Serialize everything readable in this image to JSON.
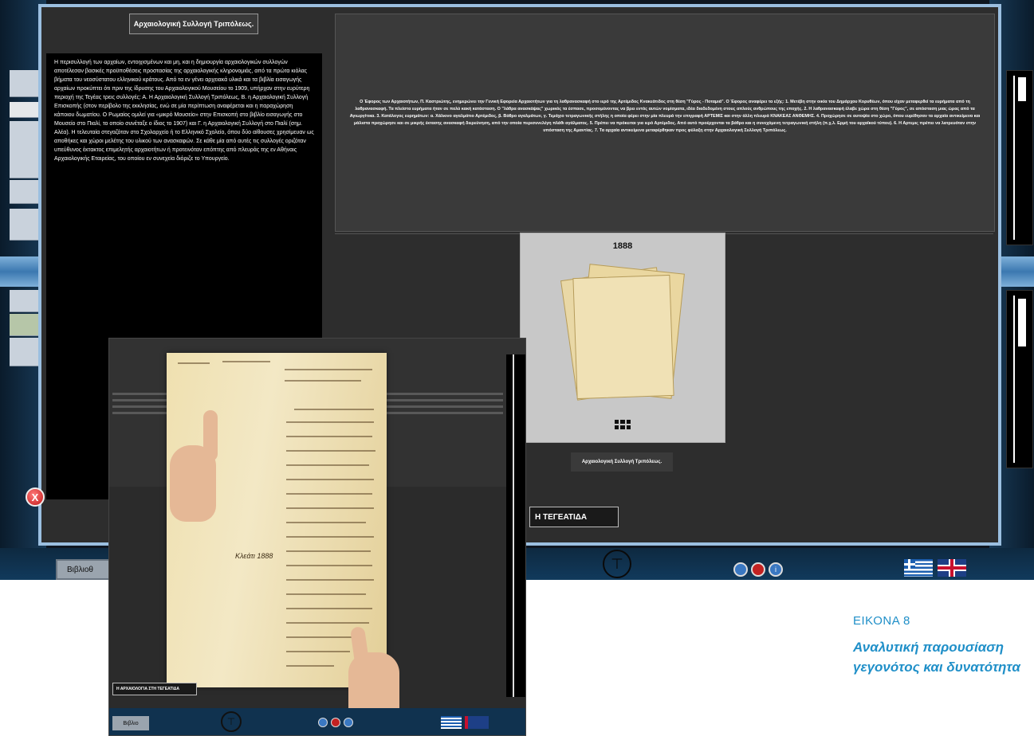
{
  "window": {
    "title": "Αρχαιολογική Συλλογή Τριπόλεως."
  },
  "left_panel": {
    "text": "Η περισυλλογή των αρχαίων, εντοιχισμένων και μη, και η δημιουργία αρχαιολογικών συλλογών αποτέλεσαν βασικές προϋποθέσεις προστασίας της αρχαιολογικής κληρονομιάς, από τα πρώτα κιόλας βήματα του νεοσύστατου ελληνικού κράτους. Από τα εν γένει αρχειακά υλικά και τα βιβλία εισαγωγής αρχαίων προκύπτει ότι πριν της ίδρυσης του Αρχαιολογικού Μουσείου το 1909, υπήρχαν στην ευρύτερη περιοχή της Τεγέας τρεις συλλογές: Α. Η Αρχαιολογική Συλλογή Τριπόλεως, Β. η Αρχαιολογική Συλλογή Επισκοπής (στον περίβολο της εκκλησίας, ενώ σε μία περίπτωση αναφέρεται και η παραχώρηση κάποιου δωματίου. Ο Ρωμαίος ομιλεί για «μικρό Μουσείο» στην Επισκοπή στο βιβλίο εισαγωγής στο Μουσείο στο Πιαλί, το οποίο συνέταξε ο ίδιος το 1907) και Γ. η Αρχαιολογική Συλλογή στο Πιαλί (σημ. Αλέα). Η τελευταία στεγαζόταν στο Σχολαρχείο ή το Ελληνικό Σχολείο, όπου δύο αίθουσες χρησίμευαν ως αποθήκες και χώροι μελέτης του υλικού των ανασκαφών. Σε κάθε μία από αυτές τις συλλογές οριζόταν υπεύθυνος έκτακτος επιμελητής αρχαιοτήτων ή προτεινόταν επόπτης από πλευράς της εν Αθήναις Αρχαιολογικής Εταιρείας, του οποίου εν συνεχεία διόριζε το Υπουργείο."
  },
  "right_panel": {
    "text": "Ο Έφορος των Αρχαιοτήτων, Π. Καστριώτης, ενημερώνει την Γενική Εφορεία Αρχαιοτήτων για τη λαθρανασκαφή στο ιερό της Αρτέμιδος Κνακεάτιδος στη θέση \"Γύρος - Ποταμιά\". Ο Έφορος αναφέρει τα εξής: 1. Μετέβη στην οικία του Δημάρχου Κορυθέων, όπου είχαν μεταφερθεί τα ευρήματα από τη λαθρανασκαφή. Τα πλείστα ευρήματα ήταν σε πολύ κακή κατάσταση. Ο \"λάθρα ανασκάψας\" χωρικός τα έσπασε, προσομένοντας να βρει εντός αυτών νομίσματα, ιδέα διαδεδομένη στους απλούς ανθρώπους της εποχής. 2. Η λαθρανασκαφή έλαβε χώρα στη θέση \"Γύρος\", σε απόσταση μιας ώρας από τα Αγιωργίτικα. 3. Κατάλογος ευρημάτων: α. Χάλκινο αγαλμάτιο Αρτέμιδος, β. Βάθρο αγαλμάτων, γ. Τεμάχιο τετραγωνικής στήλης η οποία φέρει στην μία πλευρά την επιγραφή ΑΡΤΕΜΙΣ και στην άλλη πλευρά ΚΝΑΚΕΑΣ ΑΝΘΕΜΗΣ. 4. Προχώρησε σε αυτοψία στο χώρο, όπου ευρέθησαν τα αρχαία αντικείμενα και μάλιστα προχώρησε και σε μικρής έκτασης ανασκαφή διερεύνηση, από την οποία περισυνελέγη πλάθι αγάλματος. 5. Πρέπει να πρόκειται για ιερό Αρτέμιδος. Από αυτό προέρχονται τα βάθρο και η συνεχόμενη τετραγωνική στήλη (π.χ.λ. Ερμή του αρχαϊκού τύπου). 6. Η Αρτεμις πρέπει να λατρευόταν στην υπόσταση της Αμαντίας. 7. Τα αρχαία αντικείμενα μεταφέρθηκαν προς φύλαξη στην Αρχαιολογική Συλλογή Τριπόλεως."
  },
  "document": {
    "year": "1888",
    "caption": "Αρχαιολογική Συλλογή Τριπόλεως."
  },
  "close_button": {
    "label": "X"
  },
  "section_tab": {
    "label": "Η ΤΕΓΕΑΤΙΔΑ"
  },
  "bottom_bar": {
    "library_button": "Βιβλιοθ",
    "buttons": [
      {
        "icon": "people-icon",
        "color": "#3a78c2"
      },
      {
        "icon": "home-icon",
        "color": "#c22222"
      },
      {
        "icon": "info-icon",
        "color": "#3a78c2",
        "label": "i"
      }
    ],
    "logo_glyph": "⊤"
  },
  "inset": {
    "section_label": "Η ΑΡΧΑΙΟΛΟΓΙΑ ΣΤΗ ΤΕΓΕΑΤΙΔΑ",
    "ms_date": "Κλεάτι 1888",
    "left_button": "Βιβλιο"
  },
  "figure_caption": {
    "number": "ΕΙΚΟΝΑ 8",
    "text": "Αναλυτική παρουσίαση γεγονότος και δυνατότητα"
  },
  "colors": {
    "accent_blue": "#1f8fc8",
    "window_frame": "#9bbfe0"
  }
}
